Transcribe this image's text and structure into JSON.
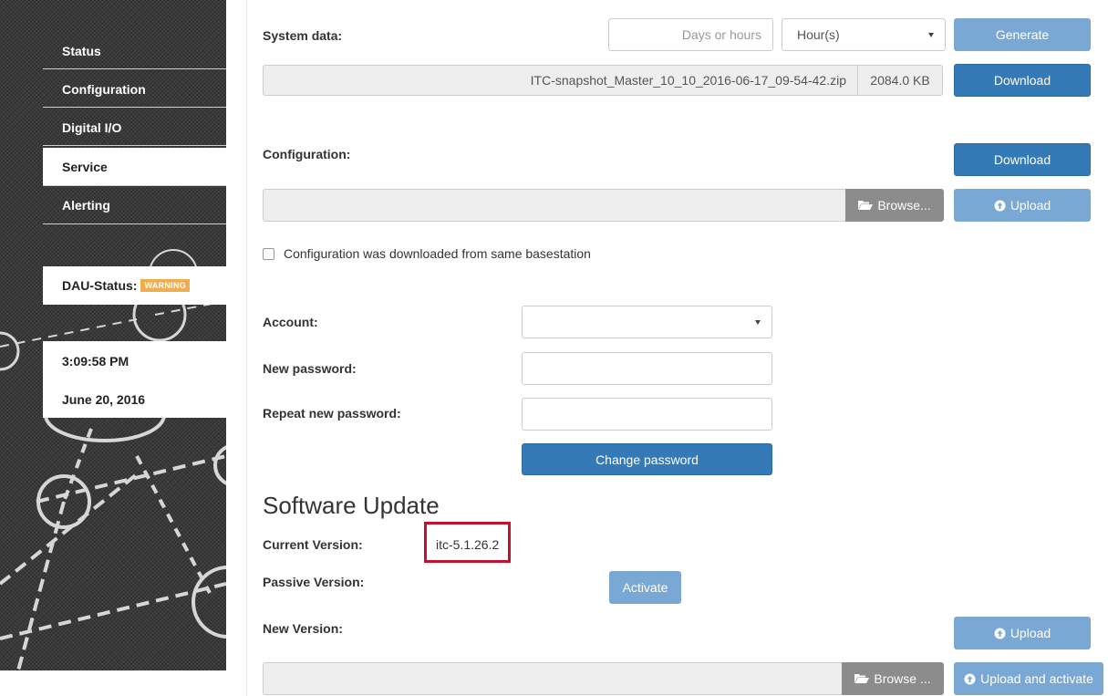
{
  "sidebar": {
    "items": [
      {
        "label": "Status",
        "active": false
      },
      {
        "label": "Configuration",
        "active": false
      },
      {
        "label": "Digital I/O",
        "active": false
      },
      {
        "label": "Service",
        "active": true
      },
      {
        "label": "Alerting",
        "active": false
      }
    ],
    "dau_status_label": "DAU-Status:",
    "dau_status_badge": "WARNING",
    "time": "3:09:58 PM",
    "date": "June 20, 2016"
  },
  "system_data": {
    "label": "System data:",
    "duration_placeholder": "Days or hours",
    "unit_select": "Hour(s)",
    "generate_label": "Generate",
    "snapshot_filename": "ITC-snapshot_Master_10_10_2016-06-17_09-54-42.zip",
    "snapshot_size": "2084.0 KB",
    "download_label": "Download"
  },
  "configuration": {
    "label": "Configuration:",
    "download_label": "Download",
    "browse_label": "Browse...",
    "upload_label": "Upload",
    "checkbox_label": "Configuration was downloaded from same basestation",
    "checkbox_checked": false
  },
  "password": {
    "account_label": "Account:",
    "account_value": "",
    "new_password_label": "New password:",
    "repeat_password_label": "Repeat new password:",
    "change_button_label": "Change password"
  },
  "software_update": {
    "heading": "Software Update",
    "current_version_label": "Current Version:",
    "current_version_value": "itc-5.1.26.2",
    "passive_version_label": "Passive Version:",
    "activate_label": "Activate",
    "new_version_label": "New Version:",
    "upload_label": "Upload",
    "browse_label": "Browse ...",
    "upload_activate_label": "Upload and activate"
  },
  "colors": {
    "primary": "#337ab7",
    "disabled": "#7aa8d4",
    "warning": "#f0ad4e",
    "highlight": "#c2122f"
  }
}
